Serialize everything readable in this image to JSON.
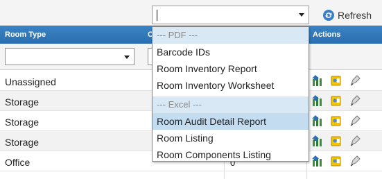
{
  "toolbar": {
    "report_select_value": "",
    "refresh_label": "Refresh"
  },
  "grid": {
    "columns": {
      "room_type": "Room Type",
      "count": "C",
      "actions": "Actions"
    },
    "filter_value": ""
  },
  "rows": [
    {
      "type": "Unassigned",
      "count": ""
    },
    {
      "type": "Storage",
      "count": ""
    },
    {
      "type": "Storage",
      "count": ""
    },
    {
      "type": "Storage",
      "count": ""
    },
    {
      "type": "Office",
      "count": "0"
    }
  ],
  "dropdown": {
    "groups": [
      {
        "label": "--- PDF ---",
        "items": [
          "Barcode IDs",
          "Room Inventory Report",
          "Room Inventory Worksheet"
        ]
      },
      {
        "label": "--- Excel ---",
        "items": [
          "Room Audit Detail Report",
          "Room Listing",
          "Room Components Listing"
        ]
      }
    ],
    "highlighted": "Room Audit Detail Report"
  },
  "colors": {
    "header_blue": "#2a6fb0",
    "highlight": "#c4dcef",
    "group_bg": "#d8e8f5"
  },
  "icons": [
    "refresh-icon",
    "move-icon",
    "note-icon",
    "edit-icon"
  ]
}
